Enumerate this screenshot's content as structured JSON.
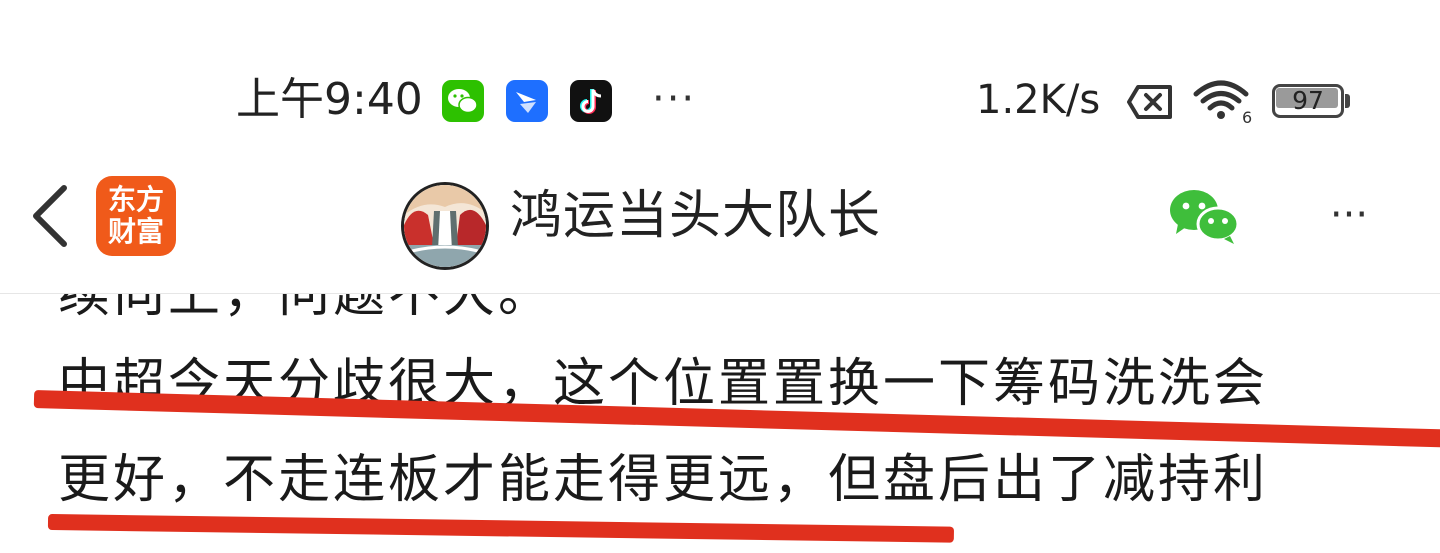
{
  "status_bar": {
    "time": "上午9:40",
    "notification_icons": [
      "wechat-icon",
      "feishu-icon",
      "tiktok-icon"
    ],
    "more": "···",
    "network_speed": "1.2K/s",
    "wifi_label": "6",
    "battery_level": "97",
    "battery_fraction": 0.97
  },
  "title_bar": {
    "brand_logo_text": "东方财富",
    "title": "鸿运当头大队长",
    "more": "···"
  },
  "article": {
    "partial_top_line": "续向上，问题不大。",
    "line_1": "中超今天分歧很大，这个位置置换一下筹码洗洗会",
    "line_2": "更好，不走连板才能走得更远，但盘后出了减持利"
  },
  "colors": {
    "underline": "#e0301e",
    "brand": "#f05a1a",
    "wechat_green": "#2dc100"
  }
}
